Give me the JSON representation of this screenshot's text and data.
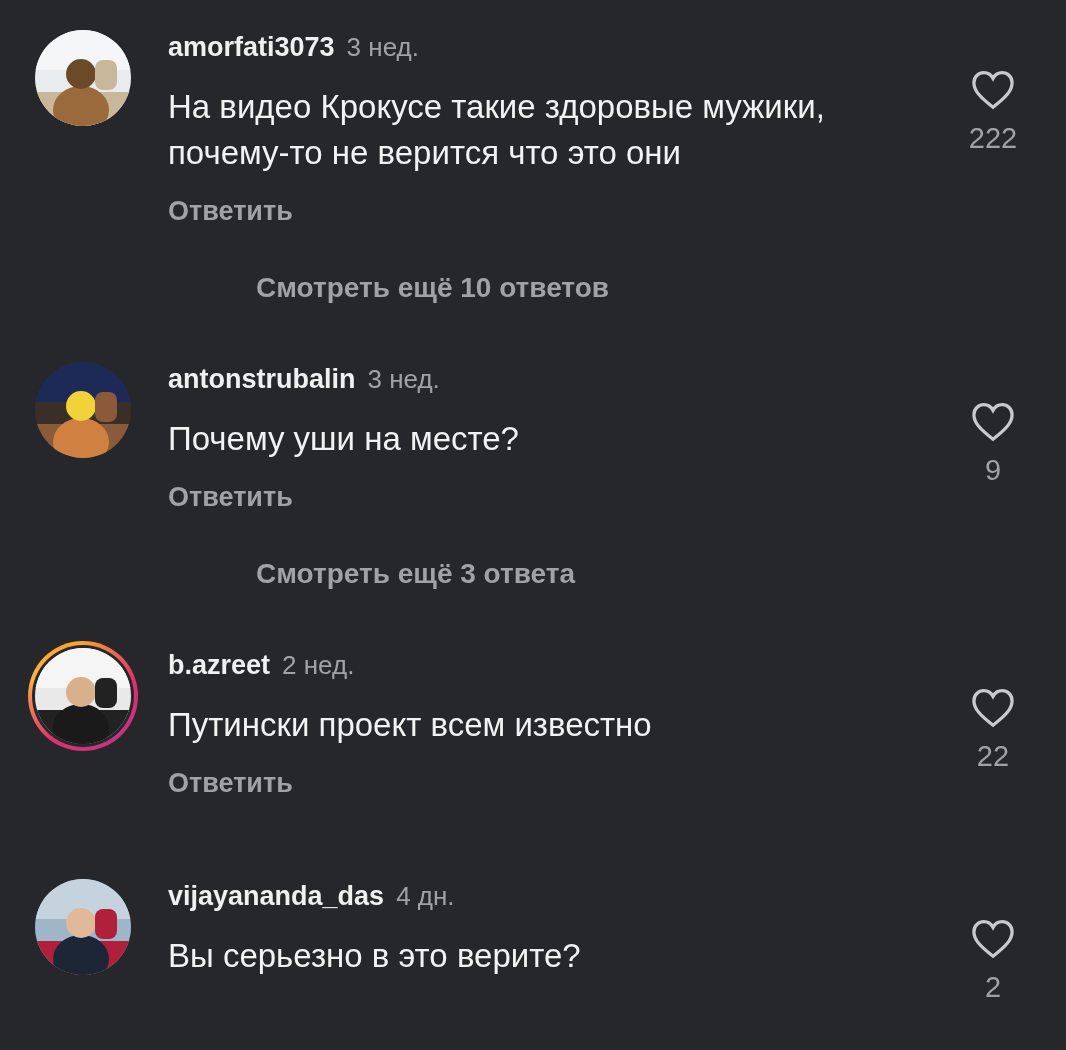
{
  "comments": [
    {
      "avatar": {
        "kind": "picture",
        "story_ring": false
      },
      "username": "amorfati3073",
      "time": "3 нед.",
      "text": "На видео Крокусе такие здоровые мужики, почему-то не верится что это они",
      "reply": "Ответить",
      "likes": "222",
      "liked": false,
      "more_replies": "Смотреть ещё 10 ответов"
    },
    {
      "avatar": {
        "kind": "picture",
        "story_ring": false
      },
      "username": "antonstrubalin",
      "time": "3 нед.",
      "text": "Почему уши на месте?",
      "reply": "Ответить",
      "likes": "9",
      "liked": false,
      "more_replies": "Смотреть ещё 3 ответа"
    },
    {
      "avatar": {
        "kind": "picture",
        "story_ring": true
      },
      "username": "b.azreet",
      "time": "2 нед.",
      "text": "Путински проект всем известно",
      "reply": "Ответить",
      "likes": "22",
      "liked": false
    },
    {
      "avatar": {
        "kind": "picture",
        "story_ring": false
      },
      "username": "vijayananda_das",
      "time": "4 дн.",
      "text": "Вы серьезно в это верите?",
      "likes": "2",
      "liked": false
    }
  ]
}
